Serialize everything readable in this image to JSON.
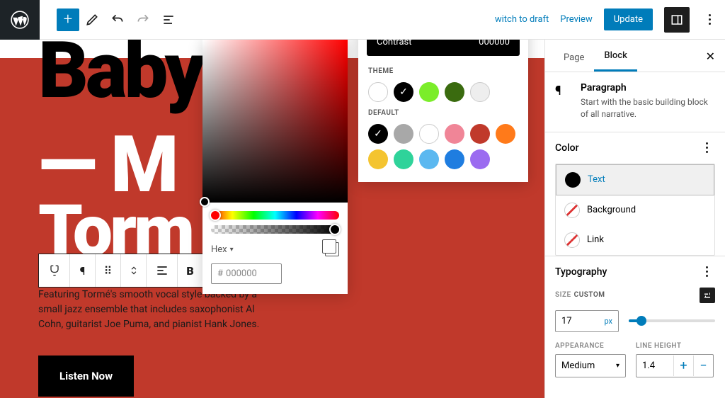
{
  "topbar": {
    "switch_draft": "witch to draft",
    "preview": "Preview",
    "update": "Update"
  },
  "canvas": {
    "title_black": "Baby",
    "title_white1": "— M",
    "title_white2": "Torm",
    "paragraph": "Featuring Tormé's smooth vocal style backed by a small jazz ensemble that includes saxophonist Al Cohn, guitarist Joe Puma, and pianist Hank Jones.",
    "listen": "Listen Now"
  },
  "picker": {
    "format_label": "Hex",
    "hex_value": "000000"
  },
  "presets": {
    "contrast_label": "Contrast",
    "contrast_value": "000000",
    "theme_label": "THEME",
    "default_label": "DEFAULT",
    "theme_colors": [
      "#ffffff",
      "#000000",
      "#7bed2a",
      "#3a6b0f",
      "#eeeeee"
    ],
    "default_colors": [
      "#000000",
      "#a8a8a8",
      "#ffffff",
      "#f08597",
      "#c0392b",
      "#ff7a1a",
      "#f4c430",
      "#2fd39a",
      "#5bb8f0",
      "#1f7de0",
      "#9b6bf0"
    ]
  },
  "sidebar": {
    "tabs": {
      "page": "Page",
      "block": "Block"
    },
    "block_title": "Paragraph",
    "block_desc": "Start with the basic building block of all narrative.",
    "color_head": "Color",
    "color_items": {
      "text": "Text",
      "bg": "Background",
      "link": "Link"
    },
    "typo_head": "Typography",
    "size_label": "SIZE",
    "custom_label": "CUSTOM",
    "size_value": "17",
    "size_unit": "px",
    "appearance_label": "APPEARANCE",
    "appearance_value": "Medium",
    "lineheight_label": "LINE HEIGHT",
    "lineheight_value": "1.4"
  }
}
